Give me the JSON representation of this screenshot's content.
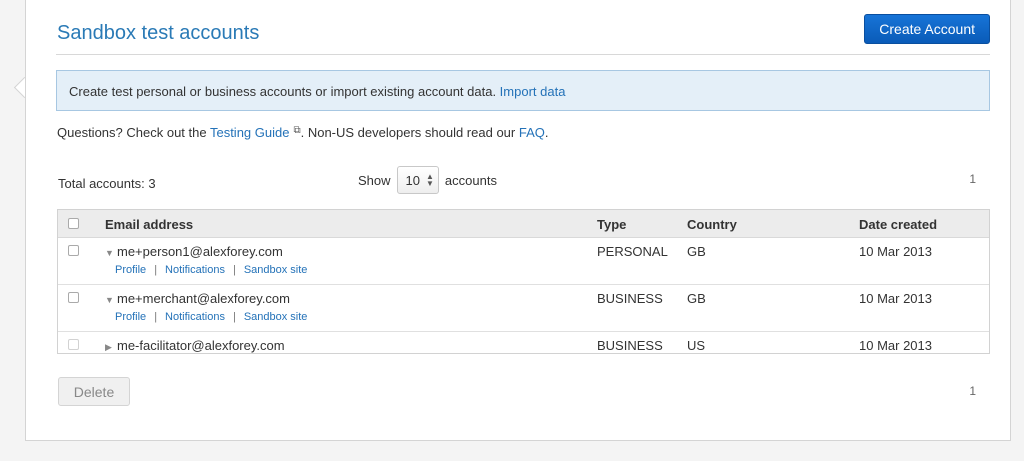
{
  "header": {
    "title": "Sandbox test accounts",
    "create_button": "Create Account"
  },
  "info": {
    "text": "Create test personal or business accounts or import existing account data. ",
    "import_link": "Import data"
  },
  "questions": {
    "prefix": "Questions? Check out the ",
    "guide_link": "Testing Guide",
    "middle": ". Non-US developers should read our ",
    "faq_link": "FAQ",
    "suffix": "."
  },
  "controls": {
    "total_label": "Total accounts: 3",
    "show_label": "Show",
    "show_value": "10",
    "accounts_label": "accounts",
    "page_top": "1",
    "page_bottom": "1"
  },
  "table": {
    "columns": [
      "Email address",
      "Type",
      "Country",
      "Date created"
    ],
    "rows": [
      {
        "email": "me+person1@alexforey.com",
        "type": "PERSONAL",
        "country": "GB",
        "date": "10 Mar 2013"
      },
      {
        "email": "me+merchant@alexforey.com",
        "type": "BUSINESS",
        "country": "GB",
        "date": "10 Mar 2013"
      },
      {
        "email": "me-facilitator@alexforey.com",
        "type": "BUSINESS",
        "country": "US",
        "date": "10 Mar 2013"
      }
    ],
    "sub_links": {
      "profile": "Profile",
      "notifications": "Notifications",
      "sandbox": "Sandbox site",
      "separator": "|"
    }
  },
  "footer": {
    "delete_button": "Delete"
  },
  "icons": {
    "external": "external-link-icon",
    "expanded": "caret-down-icon",
    "collapsed": "caret-right-icon"
  },
  "colors": {
    "title": "#2a7ab6",
    "primary_button": "#0a5bb8",
    "info_bg": "#e4eff8",
    "link": "#2472b8"
  }
}
